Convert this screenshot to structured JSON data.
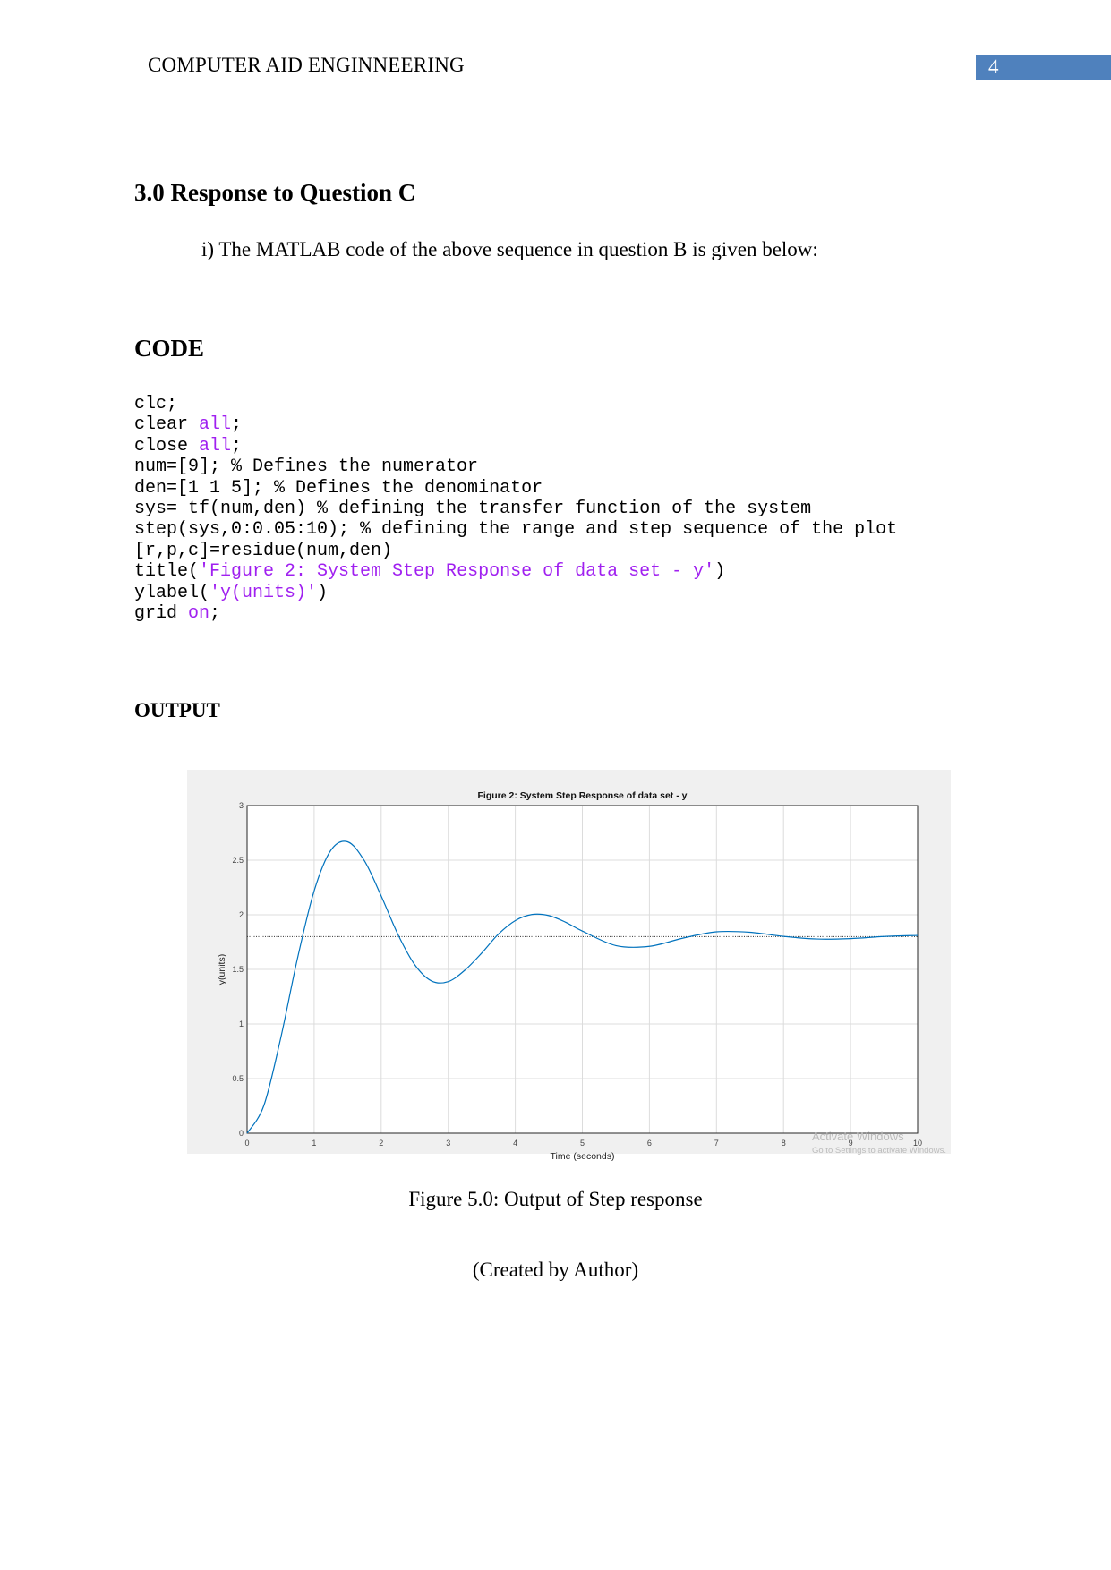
{
  "header": {
    "title": "COMPUTER AID ENGINNEERING",
    "page_number": "4",
    "accent": "#4f81bd"
  },
  "section": {
    "heading": "3.0 Response to Question C",
    "intro": "i) The MATLAB code of the above sequence in question B is given below:",
    "code_heading": "CODE",
    "code_lines": [
      [
        {
          "t": "clc;",
          "k": false
        }
      ],
      [
        {
          "t": "clear ",
          "k": false
        },
        {
          "t": "all",
          "k": true
        },
        {
          "t": ";",
          "k": false
        }
      ],
      [
        {
          "t": "close ",
          "k": false
        },
        {
          "t": "all",
          "k": true
        },
        {
          "t": ";",
          "k": false
        }
      ],
      [
        {
          "t": "num=[9]; % Defines the numerator",
          "k": false
        }
      ],
      [
        {
          "t": "den=[1 1 5]; % Defines the denominator",
          "k": false
        }
      ],
      [
        {
          "t": "sys= tf(num,den) % defining the transfer function of the system",
          "k": false
        }
      ],
      [
        {
          "t": "step(sys,0:0.05:10); % defining the range and step sequence of the plot",
          "k": false
        }
      ],
      [
        {
          "t": "[r,p,c]=residue(num,den)",
          "k": false
        }
      ],
      [
        {
          "t": "title(",
          "k": false
        },
        {
          "t": "'Figure 2: System Step Response of data set - y'",
          "k": true
        },
        {
          "t": ")",
          "k": false
        }
      ],
      [
        {
          "t": "ylabel(",
          "k": false
        },
        {
          "t": "'y(units)'",
          "k": true
        },
        {
          "t": ")",
          "k": false
        }
      ],
      [
        {
          "t": "grid ",
          "k": false
        },
        {
          "t": "on",
          "k": true
        },
        {
          "t": ";",
          "k": false
        }
      ]
    ],
    "string_color": "#a020f0",
    "output_heading": "OUTPUT",
    "caption": "Figure 5.0: Output of Step response",
    "credit": "(Created by Author)"
  },
  "chart_data": {
    "type": "line",
    "title": "Figure 2: System Step Response of data set - y",
    "xlabel": "Time (seconds)",
    "ylabel": "y(units)",
    "xlim": [
      0,
      10
    ],
    "ylim": [
      0,
      3
    ],
    "xticks": [
      "0",
      "1",
      "2",
      "3",
      "4",
      "5",
      "6",
      "7",
      "8",
      "9",
      "10"
    ],
    "yticks": [
      "0",
      "0.5",
      "1",
      "1.5",
      "2",
      "2.5",
      "3"
    ],
    "grid": true,
    "line_color": "#0072bd",
    "steady_state": 1.8,
    "x": [
      0,
      0.25,
      0.5,
      0.75,
      1,
      1.25,
      1.5,
      1.75,
      2,
      2.25,
      2.5,
      2.75,
      3,
      3.25,
      3.5,
      3.75,
      4,
      4.25,
      4.5,
      4.75,
      5,
      5.5,
      6,
      6.5,
      7,
      7.5,
      8,
      8.5,
      9,
      9.5,
      10
    ],
    "y": [
      0,
      0.253,
      0.867,
      1.596,
      2.219,
      2.591,
      2.668,
      2.494,
      2.172,
      1.82,
      1.543,
      1.394,
      1.388,
      1.494,
      1.65,
      1.824,
      1.947,
      2.003,
      1.993,
      1.932,
      1.851,
      1.718,
      1.711,
      1.786,
      1.844,
      1.84,
      1.802,
      1.778,
      1.782,
      1.801,
      1.811
    ],
    "watermark": [
      "Activate Windows",
      "Go to Settings to activate Windows."
    ]
  }
}
